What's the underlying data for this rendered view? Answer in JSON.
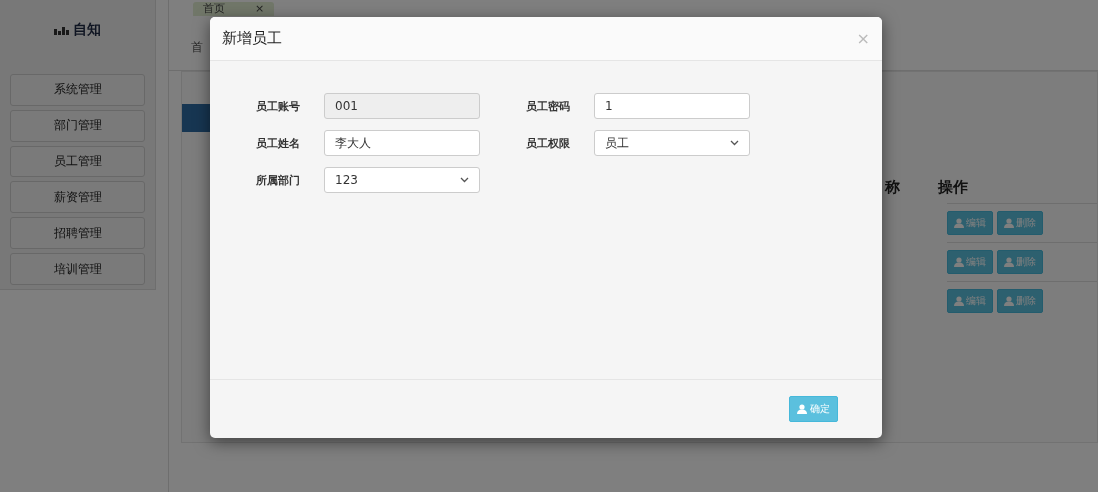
{
  "sidebar": {
    "logo": "自知",
    "items": [
      {
        "label": "系统管理"
      },
      {
        "label": "部门管理"
      },
      {
        "label": "员工管理"
      },
      {
        "label": "薪资管理"
      },
      {
        "label": "招聘管理"
      },
      {
        "label": "培训管理"
      }
    ]
  },
  "tabs": [
    {
      "label": "首页",
      "close": "×",
      "selected": true
    }
  ],
  "breadcrumb": "首",
  "table": {
    "columns": [
      "称",
      "操作"
    ],
    "rows": [
      {
        "actions": [
          "编辑",
          "删除"
        ]
      },
      {
        "actions": [
          "编辑",
          "删除"
        ]
      },
      {
        "actions": [
          "编辑",
          "删除"
        ]
      }
    ]
  },
  "dialog": {
    "title": "新增员工",
    "close": "×",
    "fields": [
      {
        "label": "员工账号",
        "kind": "input",
        "value": "001",
        "disabled": true
      },
      {
        "label": "员工密码",
        "kind": "input",
        "value": "1",
        "disabled": false
      },
      {
        "label": "员工姓名",
        "kind": "input",
        "value": "李大人",
        "disabled": false
      },
      {
        "label": "员工权限",
        "kind": "select",
        "value": "员工",
        "disabled": false
      },
      {
        "label": "所属部门",
        "kind": "select",
        "value": "123",
        "disabled": false
      }
    ],
    "confirm": "确定"
  }
}
